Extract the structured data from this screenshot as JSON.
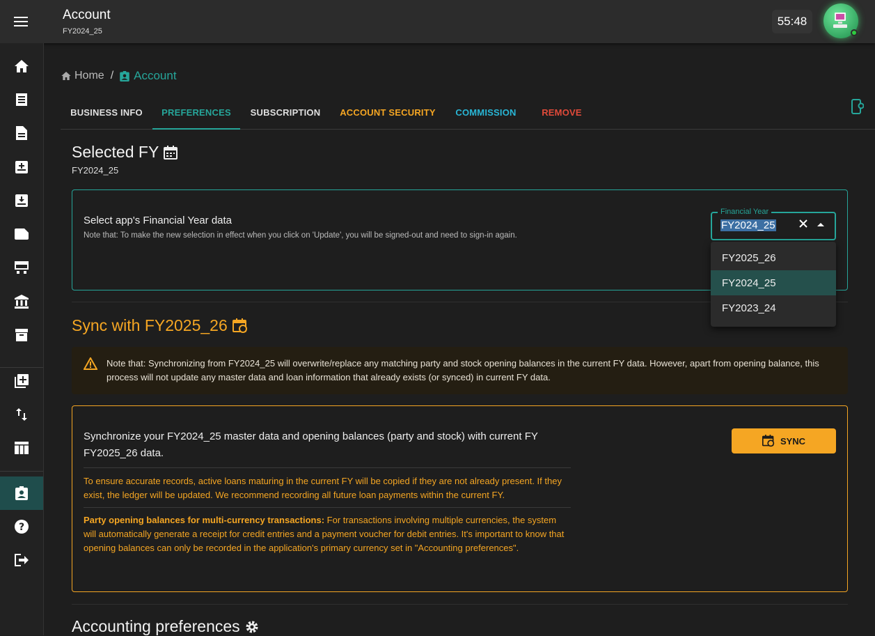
{
  "appbar": {
    "title": "Account",
    "subtitle": "FY2024_25",
    "timer": "55:48",
    "menu_icon": "menu-icon",
    "avatar_icon": "avatar-icon"
  },
  "sidebar": {
    "items": [
      {
        "icon": "home-icon"
      },
      {
        "icon": "receipt-icon"
      },
      {
        "icon": "description-icon"
      },
      {
        "icon": "inbox-in-icon"
      },
      {
        "icon": "inbox-download-icon"
      },
      {
        "icon": "label-icon"
      },
      {
        "icon": "calendar-view-icon"
      },
      {
        "icon": "bank-icon"
      },
      {
        "icon": "archive-icon"
      },
      {
        "icon": "library-add-icon"
      },
      {
        "icon": "swap-vert-icon"
      },
      {
        "icon": "table-icon"
      },
      {
        "icon": "account-box-icon",
        "active": true
      },
      {
        "icon": "help-icon"
      },
      {
        "icon": "logout-icon"
      }
    ]
  },
  "breadcrumb": {
    "home": "Home",
    "separator": "/",
    "current": "Account"
  },
  "tabs": [
    {
      "label": "BUSINESS INFO",
      "color": "#e0e0e0"
    },
    {
      "label": "PREFERENCES",
      "color": "#26a69a",
      "active": true
    },
    {
      "label": "SUBSCRIPTION",
      "color": "#e0e0e0"
    },
    {
      "label": "ACCOUNT SECURITY",
      "color": "#f5a623"
    },
    {
      "label": "COMMISSION",
      "color": "#29b6d6"
    },
    {
      "label": "REMOVE",
      "color": "#e04a3a"
    }
  ],
  "selected_fy": {
    "title": "Selected FY",
    "value": "FY2024_25",
    "box_title": "Select app's Financial Year data",
    "box_note": "Note that: To make the new selection in effect when you click on 'Update', you will be signed-out and need to sign-in again.",
    "field_label": "Financial Year",
    "field_value": "FY2024_25",
    "options": [
      "FY2025_26",
      "FY2024_25",
      "FY2023_24"
    ],
    "selected_option": "FY2024_25"
  },
  "sync": {
    "title": "Sync with FY2025_26",
    "warning": "Note that: Synchronizing from FY2024_25 will overwrite/replace any matching party and stock opening balances in the current FY data. However, apart from opening balance, this process will not update any master data and loan information that already exists (or synced) in current FY data.",
    "box_title": "Synchronize your FY2024_25 master data and opening balances (party and stock) with current FY FY2025_26 data.",
    "para1": "To ensure accurate records, active loans maturing in the current FY will be copied if they are not already present. If they exist, the ledger will be updated. We recommend recording all future loan payments within the current FY.",
    "para2_bold": "Party opening balances for multi-currency transactions:",
    "para2_rest": " For transactions involving multiple currencies, the system will automatically generate a receipt for credit entries and a payment voucher for debit entries. It's important to know that opening balances can only be recorded in the application's primary currency set in \"Accounting preferences\".",
    "button": "SYNC"
  },
  "accounting": {
    "title": "Accounting preferences"
  },
  "colors": {
    "accent": "#26a69a",
    "warning": "#f5a623",
    "danger": "#e04a3a",
    "info": "#29b6d6"
  }
}
